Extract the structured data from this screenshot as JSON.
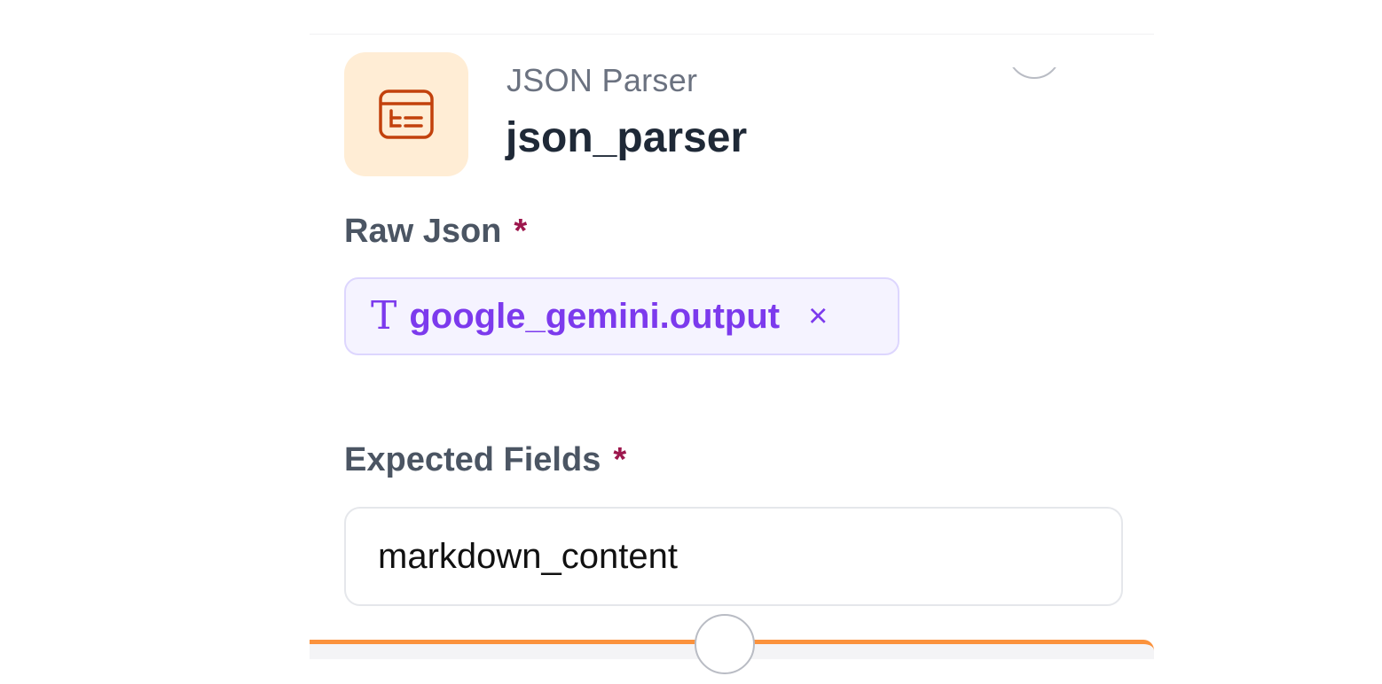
{
  "node": {
    "type_label": "JSON Parser",
    "name": "json_parser",
    "icon": "json-parser-icon",
    "accent_color": "#c2410c",
    "icon_bg_color": "#ffedd5"
  },
  "fields": {
    "raw_json": {
      "label": "Raw Json",
      "required_mark": "*",
      "variable": {
        "type_icon": "text-type-icon",
        "type_glyph": "T",
        "value": "google_gemini.output",
        "remove_glyph": "×"
      }
    },
    "expected_fields": {
      "label": "Expected Fields",
      "required_mark": "*",
      "value": "markdown_content"
    }
  },
  "colors": {
    "variable_text": "#7c3aed",
    "variable_bg": "#f5f3ff",
    "required": "#9d174d",
    "bottom_bar": "#fb923c"
  }
}
